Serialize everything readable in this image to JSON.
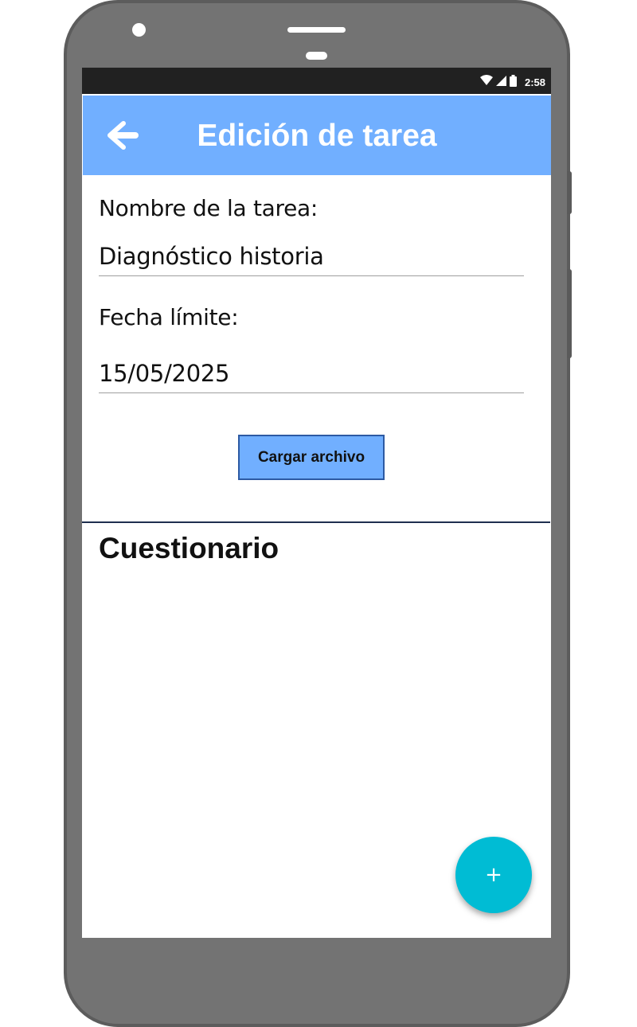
{
  "status_bar": {
    "time": "2:58",
    "icons": [
      "wifi-icon",
      "cell-signal-icon",
      "battery-icon"
    ]
  },
  "app_bar": {
    "back_icon": "arrow-left-icon",
    "title": "Edición de tarea",
    "color": "#71afff"
  },
  "form": {
    "task_name_label": "Nombre de la tarea:",
    "task_name_value": "Diagnóstico historia",
    "due_date_label": "Fecha límite:",
    "due_date_value": "15/05/2025",
    "upload_button_label": "Cargar archivo"
  },
  "questionnaire": {
    "title": "Cuestionario"
  },
  "fab": {
    "label": "+",
    "icon": "plus-icon",
    "color": "#00bcd4"
  }
}
